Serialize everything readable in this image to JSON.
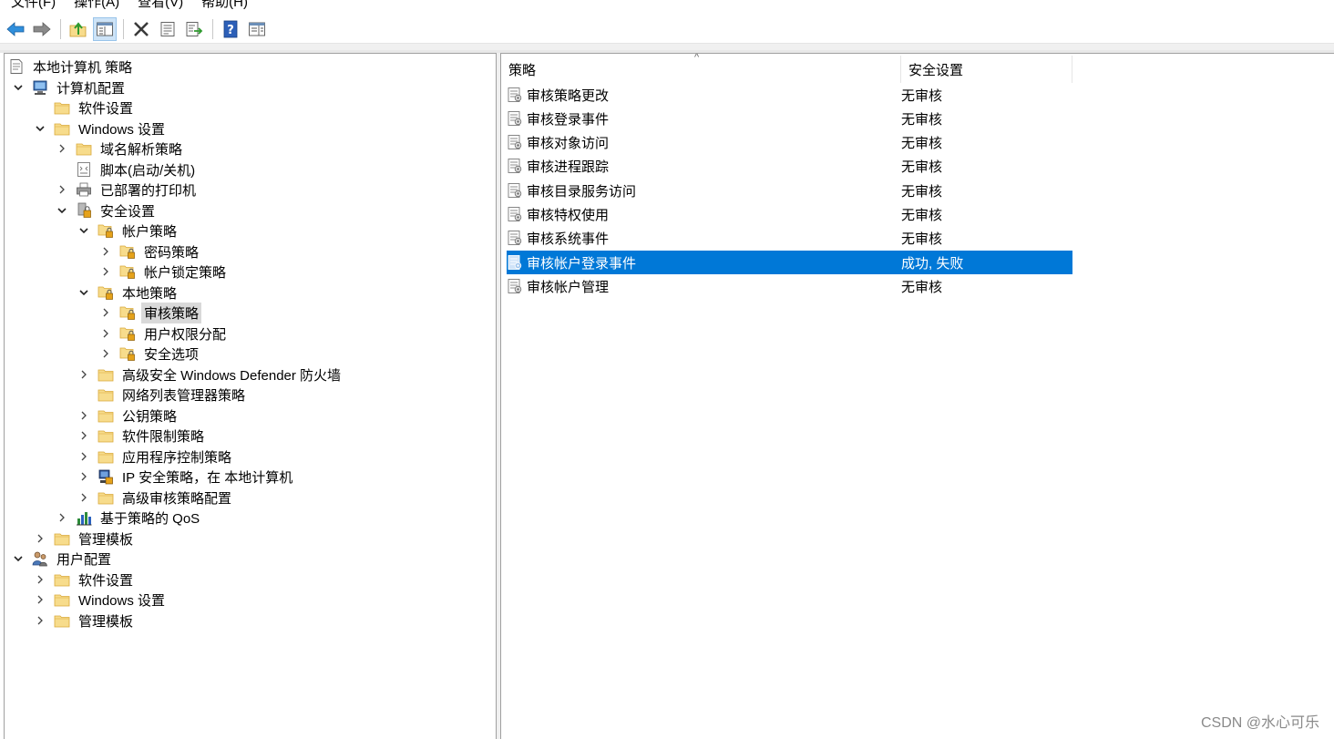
{
  "menubar": {
    "items": [
      "文件(F)",
      "操作(A)",
      "查看(V)",
      "帮助(H)"
    ]
  },
  "toolbar": {
    "buttons": [
      "back-arrow-icon",
      "forward-arrow-icon",
      "up-folder-icon",
      "show-hide-tree-icon",
      "delete-icon",
      "properties-icon",
      "export-list-icon",
      "help-icon",
      "show-action-pane-icon"
    ]
  },
  "tree": {
    "root": "本地计算机 策略",
    "computer_config": "计算机配置",
    "software_settings": "软件设置",
    "windows_settings": "Windows 设置",
    "dns_policy": "域名解析策略",
    "scripts": "脚本(启动/关机)",
    "printers": "已部署的打印机",
    "security_settings": "安全设置",
    "account_policies": "帐户策略",
    "password_policy": "密码策略",
    "lockout_policy": "帐户锁定策略",
    "local_policies": "本地策略",
    "audit_policy": "审核策略",
    "user_rights": "用户权限分配",
    "security_options": "安全选项",
    "defender_firewall": "高级安全 Windows Defender 防火墙",
    "network_list": "网络列表管理器策略",
    "public_key": "公钥策略",
    "software_restriction": "软件限制策略",
    "app_control": "应用程序控制策略",
    "ip_security": "IP 安全策略，在 本地计算机",
    "advanced_audit": "高级审核策略配置",
    "qos": "基于策略的 QoS",
    "admin_templates": "管理模板",
    "user_config": "用户配置",
    "user_software_settings": "软件设置",
    "user_windows_settings": "Windows 设置",
    "user_admin_templates": "管理模板"
  },
  "list": {
    "col_policy": "策略",
    "col_setting": "安全设置",
    "rows": [
      {
        "name": "审核策略更改",
        "value": "无审核"
      },
      {
        "name": "审核登录事件",
        "value": "无审核"
      },
      {
        "name": "审核对象访问",
        "value": "无审核"
      },
      {
        "name": "审核进程跟踪",
        "value": "无审核"
      },
      {
        "name": "审核目录服务访问",
        "value": "无审核"
      },
      {
        "name": "审核特权使用",
        "value": "无审核"
      },
      {
        "name": "审核系统事件",
        "value": "无审核"
      },
      {
        "name": "审核帐户登录事件",
        "value": "成功, 失败"
      },
      {
        "name": "审核帐户管理",
        "value": "无审核"
      }
    ]
  },
  "colors": {
    "selection": "#0078d7",
    "tree_selection": "#d9d9d9",
    "folder": "#f4d37a"
  },
  "watermark": "CSDN @水心可乐"
}
